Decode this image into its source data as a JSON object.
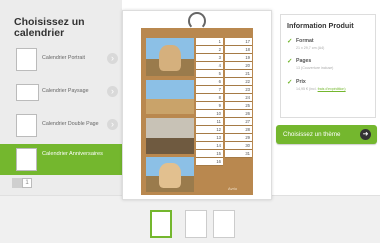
{
  "page": {
    "title": "Choisissez un calendrier"
  },
  "calendar_types": [
    {
      "label": "Calendrier Portrait"
    },
    {
      "label": "Calendrier Paysage"
    },
    {
      "label": "Calendrier Double Page"
    },
    {
      "label": "Calendrier Anniversaires"
    }
  ],
  "info": {
    "title": "Information Produit",
    "format_label": "Format",
    "format_value": "21 x 29,7 cm (A4)",
    "pages_label": "Pages",
    "pages_value": "13 (Couverture incluse)",
    "prix_label": "Prix",
    "prix_value": "14,95 € (incl.",
    "prix_link": "frais d'expédition)"
  },
  "cta": {
    "label": "Choisissez un thème"
  },
  "pager": {
    "box": "1"
  },
  "preview": {
    "days_left": [
      "1",
      "2",
      "3",
      "4",
      "5",
      "6",
      "7",
      "8",
      "9",
      "10",
      "11",
      "12",
      "13",
      "14",
      "15",
      "16"
    ],
    "days_right": [
      "17",
      "18",
      "19",
      "20",
      "21",
      "22",
      "23",
      "24",
      "25",
      "26",
      "27",
      "28",
      "29",
      "30",
      "31"
    ],
    "brand": "Avrio"
  },
  "colors": {
    "accent": "#74b72e",
    "calendar_brown": "#b9884f"
  }
}
